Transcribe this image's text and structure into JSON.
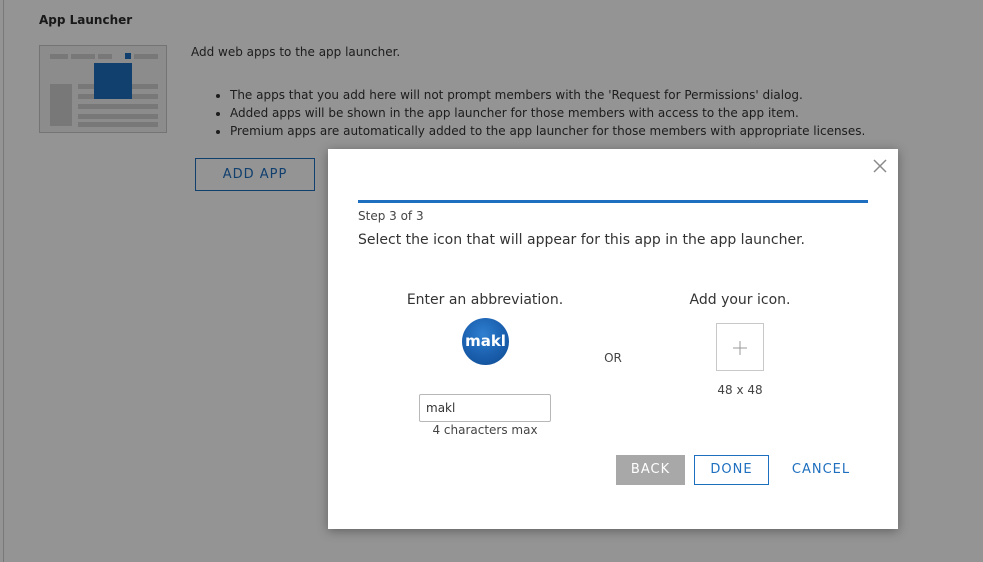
{
  "page": {
    "section_title": "App Launcher",
    "intro": "Add web apps to the app launcher.",
    "bullets": [
      "The apps that you add here will not prompt members with the 'Request for Permissions' dialog.",
      "Added apps will be shown in the app launcher for those members with access to the app item.",
      "Premium apps are automatically added to the app launcher for those members with appropriate licenses."
    ],
    "add_app_label": "ADD APP"
  },
  "modal": {
    "step": "Step 3 of 3",
    "progress": 1.0,
    "instruction": "Select the icon that will appear for this app in the app launcher.",
    "abbreviation": {
      "heading": "Enter an abbreviation.",
      "preview_text": "makl",
      "input_value": "makl",
      "hint": "4 characters max"
    },
    "or_label": "OR",
    "icon": {
      "heading": "Add your icon.",
      "size_label": "48 x 48",
      "upload_icon": "plus-icon"
    },
    "buttons": {
      "back": "BACK",
      "done": "DONE",
      "cancel": "CANCEL"
    },
    "close_icon": "close-icon"
  },
  "colors": {
    "accent": "#1e6fbf",
    "disabled_button": "#a8a8a8",
    "overlay": "rgba(0,0,0,0.42)"
  }
}
